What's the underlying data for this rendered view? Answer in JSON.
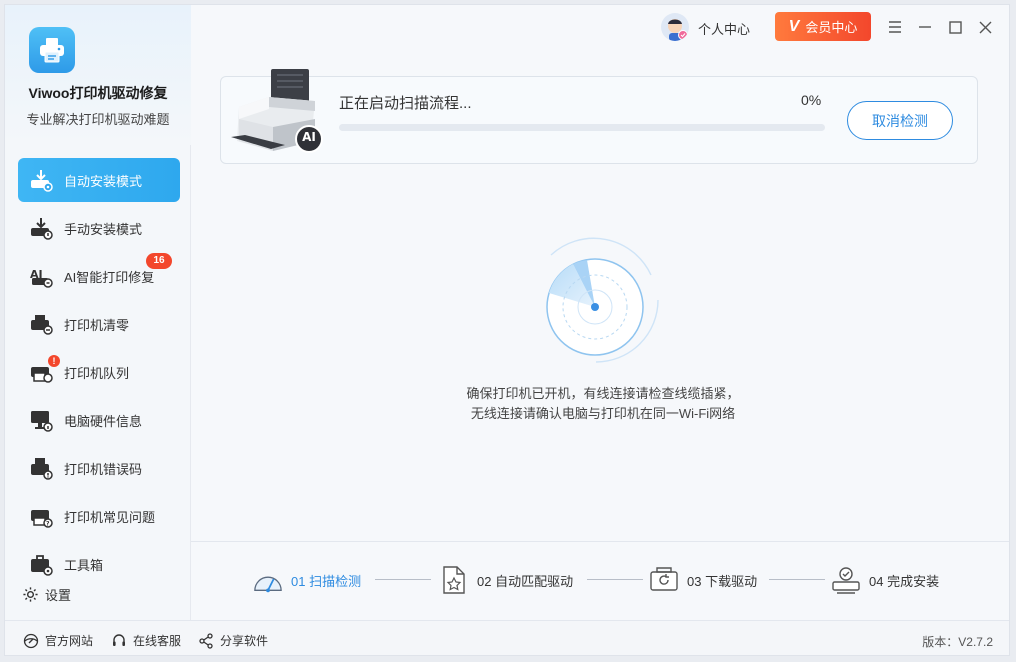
{
  "app": {
    "name": "Viwoo打印机驱动修复",
    "subtitle": "专业解决打印机驱动难题"
  },
  "sidebar": {
    "items": [
      {
        "label": "自动安装模式",
        "active": true
      },
      {
        "label": "手动安装模式"
      },
      {
        "label": "AI智能打印修复",
        "badge": "16"
      },
      {
        "label": "打印机清零"
      },
      {
        "label": "打印机队列",
        "alert": "!"
      },
      {
        "label": "电脑硬件信息"
      },
      {
        "label": "打印机错误码"
      },
      {
        "label": "打印机常见问题"
      },
      {
        "label": "工具箱"
      }
    ],
    "settings_label": "设置"
  },
  "titlebar": {
    "personal_label": "个人中心",
    "vip_label": "会员中心",
    "vip_icon": "V"
  },
  "scan": {
    "status": "正在启动扫描流程...",
    "percent_text": "0%",
    "progress": 0,
    "cancel_label": "取消检测",
    "printer_badge": "AI"
  },
  "hint": {
    "line1": "确保打印机已开机，有线连接请检查线缆插紧，",
    "line2": "无线连接请确认电脑与打印机在同一Wi-Fi网络"
  },
  "steps": [
    {
      "label": "01 扫描检测",
      "active": true
    },
    {
      "label": "02 自动匹配驱动"
    },
    {
      "label": "03 下载驱动"
    },
    {
      "label": "04 完成安装"
    }
  ],
  "footer": {
    "website": "官方网站",
    "support": "在线客服",
    "share": "分享软件",
    "version": "版本：V2.7.2"
  },
  "colors": {
    "accent": "#2e9ae8",
    "active_nav": "#3fb6f4",
    "badge": "#f3472c",
    "vip": "#f3472c"
  }
}
